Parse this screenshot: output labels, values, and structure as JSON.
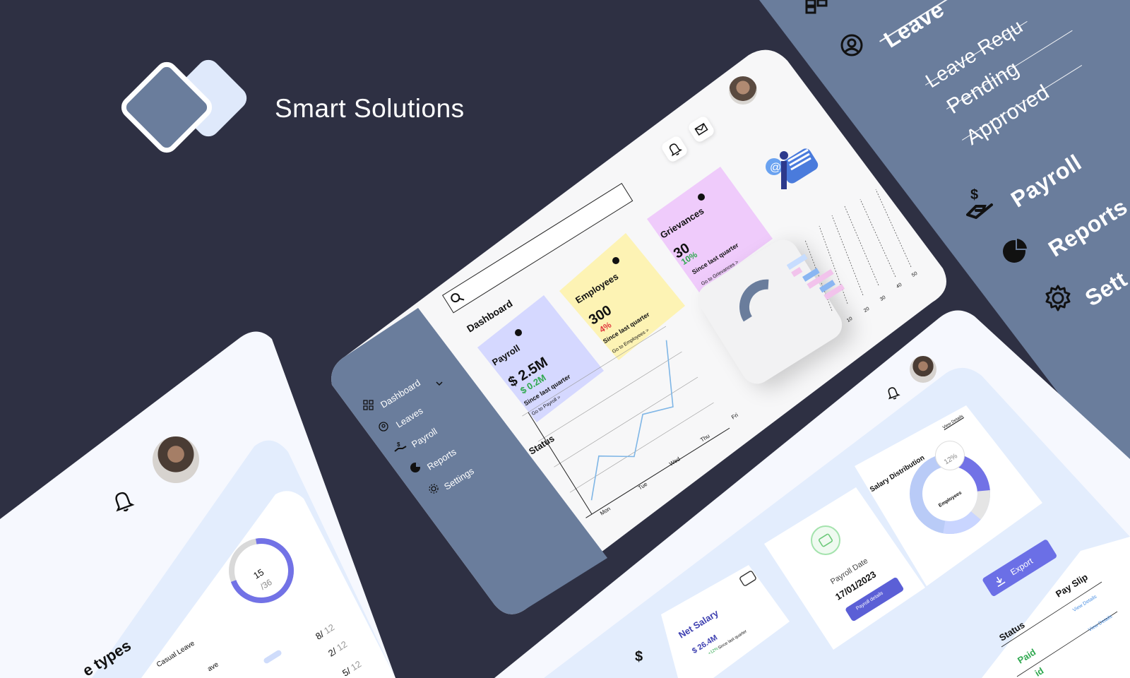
{
  "brand": {
    "name": "Smart Solutions"
  },
  "colors": {
    "background": "#2e3043",
    "sidebar": "#6a7d9c",
    "accent": "#5b5fd6",
    "payroll_card": "#d5d8ff",
    "employees_card": "#fdf3b4",
    "grievances_card": "#efcbfb",
    "positive": "#2fa84f",
    "negative": "#e0353b"
  },
  "right_sidebar": {
    "items": [
      {
        "label": "Leave",
        "icon": "user-circle-icon"
      },
      {
        "label": "Leave Requ",
        "icon": ""
      },
      {
        "label": "Pending",
        "icon": ""
      },
      {
        "label": "Approved",
        "icon": ""
      },
      {
        "label": "Payroll",
        "icon": "hand-dollar-icon"
      },
      {
        "label": "Reports",
        "icon": "pie-chart-icon"
      },
      {
        "label": "Sett",
        "icon": "gear-icon"
      }
    ]
  },
  "dashboard": {
    "title": "Dashboard",
    "search_placeholder": "",
    "nav": [
      {
        "label": "Dashboard",
        "icon": "grid-icon"
      },
      {
        "label": "Leaves",
        "icon": "user-circle-icon"
      },
      {
        "label": "Payroll",
        "icon": "hand-dollar-icon"
      },
      {
        "label": "Reports",
        "icon": "pie-chart-icon"
      },
      {
        "label": "Settings",
        "icon": "gear-icon"
      }
    ],
    "cards": [
      {
        "title": "Payroll",
        "value": "$ 2.5M",
        "delta": "$ 0.2M",
        "since": "Since last quarter",
        "link": "Go to Payroll >"
      },
      {
        "title": "Employees",
        "value": "300",
        "delta": "4%",
        "since": "Since last quarter",
        "link": "Go to Employees >"
      },
      {
        "title": "Grievances",
        "value": "30",
        "delta": "10%",
        "since": "Since last quarter",
        "link": "Go to Grievances >"
      }
    ],
    "status_title": "Status",
    "status_chart": {
      "type": "line",
      "categories": [
        "Mon",
        "Tue",
        "Wed",
        "Thu",
        "Fri"
      ],
      "values": [
        10,
        38,
        22,
        48,
        40,
        90
      ]
    },
    "bar_chart": {
      "type": "bar",
      "ticks": [
        "10",
        "20",
        "30",
        "40",
        "50"
      ]
    }
  },
  "bottom_left": {
    "ring_value": "15",
    "ring_total": "/36",
    "section_title": "e types",
    "rows": [
      {
        "label": "Casual Leave",
        "value": "8/",
        "total": "12"
      },
      {
        "label": "ave",
        "value": "2/",
        "total": "12"
      },
      {
        "label": "",
        "value": "5/",
        "total": "12"
      }
    ]
  },
  "payroll": {
    "net_salary_label": "Net Salary",
    "net_salary_value": "$ 26.4M",
    "net_salary_delta": "+12%",
    "net_salary_since": "Since last quarter",
    "payroll_date_label": "Payroll Date",
    "payroll_date_value": "17/01/2023",
    "payroll_details_button": "Payroll details",
    "salary_distribution_title": "Salary Distribution",
    "view_details": "View Details",
    "donut_center": "Employees",
    "donut_badge": "12%",
    "export_button": "Export",
    "table_headers": [
      "Status",
      "Pay Slip"
    ],
    "table_rows": [
      {
        "status": "Paid",
        "slip": "View Details"
      },
      {
        "status": "id",
        "slip": "View Details"
      }
    ]
  }
}
